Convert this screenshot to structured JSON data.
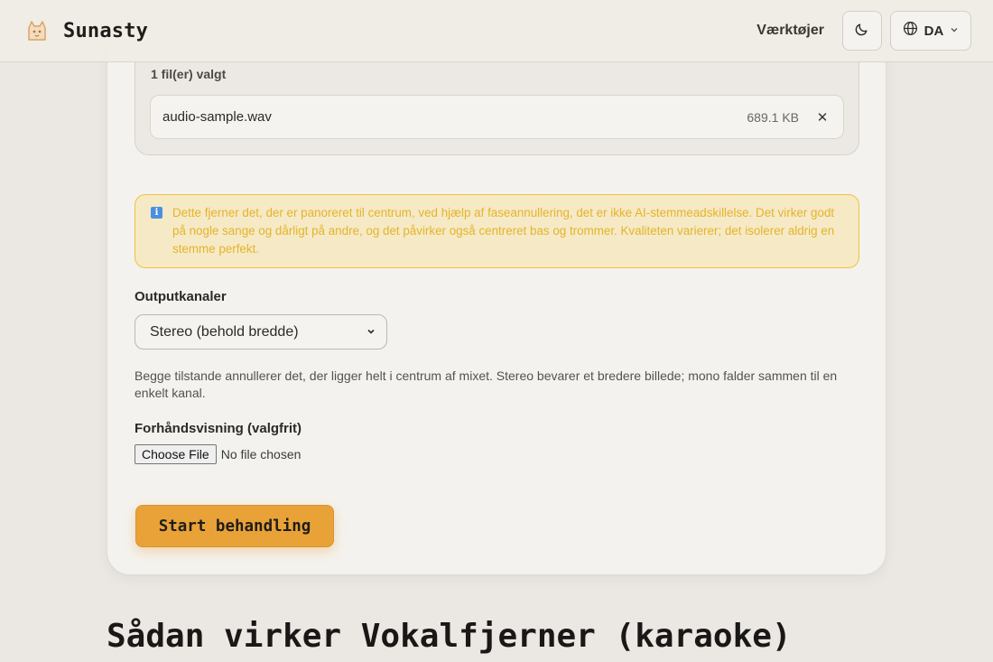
{
  "header": {
    "brand_name": "Sunasty",
    "logo_icon": "cat-logo-icon",
    "nav_tools": "Værktøjer",
    "theme_icon": "moon-icon",
    "lang_icon": "globe-icon",
    "lang_label": "DA",
    "lang_chevron_icon": "chevron-down-icon"
  },
  "file_panel": {
    "count_label": "1 fil(er) valgt",
    "files": [
      {
        "name": "audio-sample.wav",
        "size": "689.1 KB",
        "remove_label": "✕"
      }
    ]
  },
  "notice": {
    "icon": "info-icon",
    "text": "Dette fjerner det, der er panoreret til centrum, ved hjælp af faseannullering, det er ikke AI-stemmeadskillelse. Det virker godt på nogle sange og dårligt på andre, og det påvirker også centreret bas og trommer. Kvaliteten varierer; det isolerer aldrig en stemme perfekt."
  },
  "output": {
    "label": "Outputkanaler",
    "selected": "Stereo (behold bredde)",
    "help": "Begge tilstande annullerer det, der ligger helt i centrum af mixet. Stereo bevarer et bredere billede; mono falder sammen til en enkelt kanal."
  },
  "preview": {
    "label": "Forhåndsvisning (valgfrit)",
    "choose_label": "Choose File",
    "status": "No file chosen"
  },
  "submit_label": "Start behandling",
  "section_heading": "Sådan virker Vokalfjerner (karaoke)",
  "colors": {
    "accent": "#e9a238",
    "notice_border": "#f0c23a",
    "notice_text": "#e3b52a",
    "background": "#ebe8e3"
  }
}
